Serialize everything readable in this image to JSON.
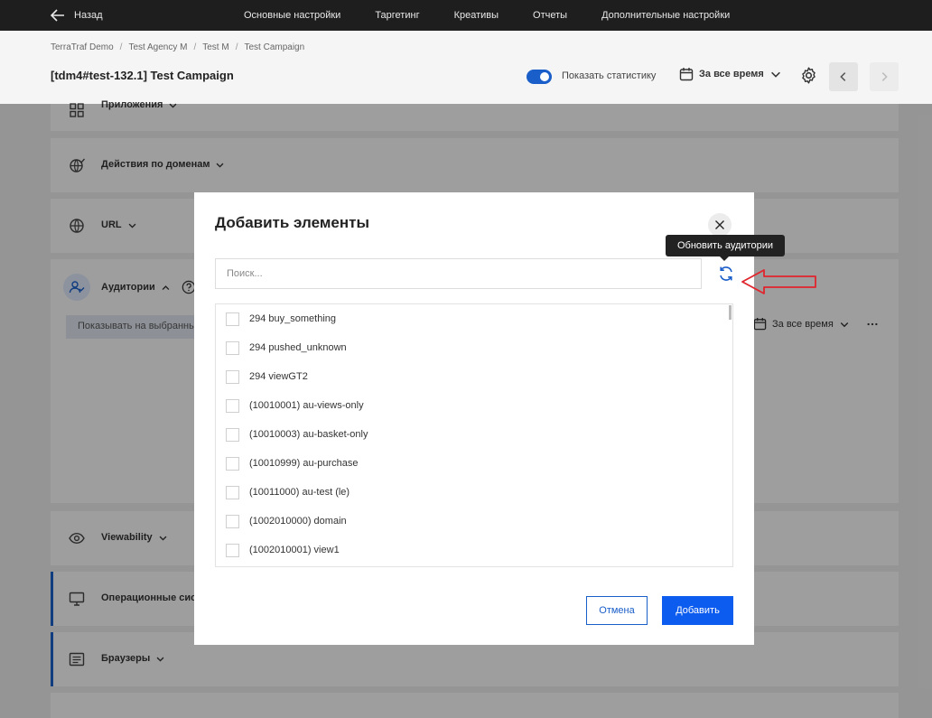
{
  "nav": {
    "back_label": "Назад",
    "tabs": [
      "Основные настройки",
      "Таргетинг",
      "Креативы",
      "Отчеты",
      "Дополнительные настройки"
    ]
  },
  "header": {
    "breadcrumbs": [
      "TerraTraf Demo",
      "Test Agency M",
      "Test M",
      "Test Campaign"
    ],
    "title": "[tdm4#test-132.1] Test Campaign",
    "show_stats_label": "Показать статистику",
    "show_stats_on": true,
    "period_label": "За все время"
  },
  "sections": {
    "apps": "Приложения",
    "domain_actions": "Действия по доменам",
    "url": "URL",
    "audiences": "Аудитории",
    "audience_filter": "Показывать на выбранных",
    "audience_period": "За все время",
    "viewability": "Viewability",
    "os": "Операционные системы",
    "browsers": "Браузеры"
  },
  "modal": {
    "title": "Добавить элементы",
    "search_placeholder": "Поиск...",
    "tooltip": "Обновить аудитории",
    "items": [
      "294 buy_something",
      "294 pushed_unknown",
      "294 viewGT2",
      "(10010001) au-views-only",
      "(10010003) au-basket-only",
      "(10010999) au-purchase",
      "(10011000) au-test (le)",
      "(1002010000) domain",
      "(1002010001) view1"
    ],
    "cancel_label": "Отмена",
    "add_label": "Добавить"
  },
  "colors": {
    "accent": "#0d5cf0",
    "topbar": "#1e1e1e",
    "annotation_arrow": "#e0242c"
  }
}
